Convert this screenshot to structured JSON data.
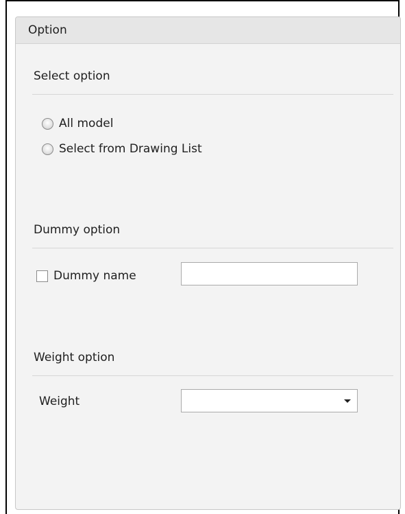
{
  "panel": {
    "title": "Option"
  },
  "select_option": {
    "title": "Select option",
    "options": [
      {
        "label": "All model",
        "selected": false
      },
      {
        "label": "Select from Drawing List",
        "selected": false
      }
    ]
  },
  "dummy_option": {
    "title": "Dummy option",
    "checkbox_label": "Dummy name",
    "checked": false,
    "name_value": ""
  },
  "weight_option": {
    "title": "Weight option",
    "label": "Weight",
    "selected_value": ""
  }
}
